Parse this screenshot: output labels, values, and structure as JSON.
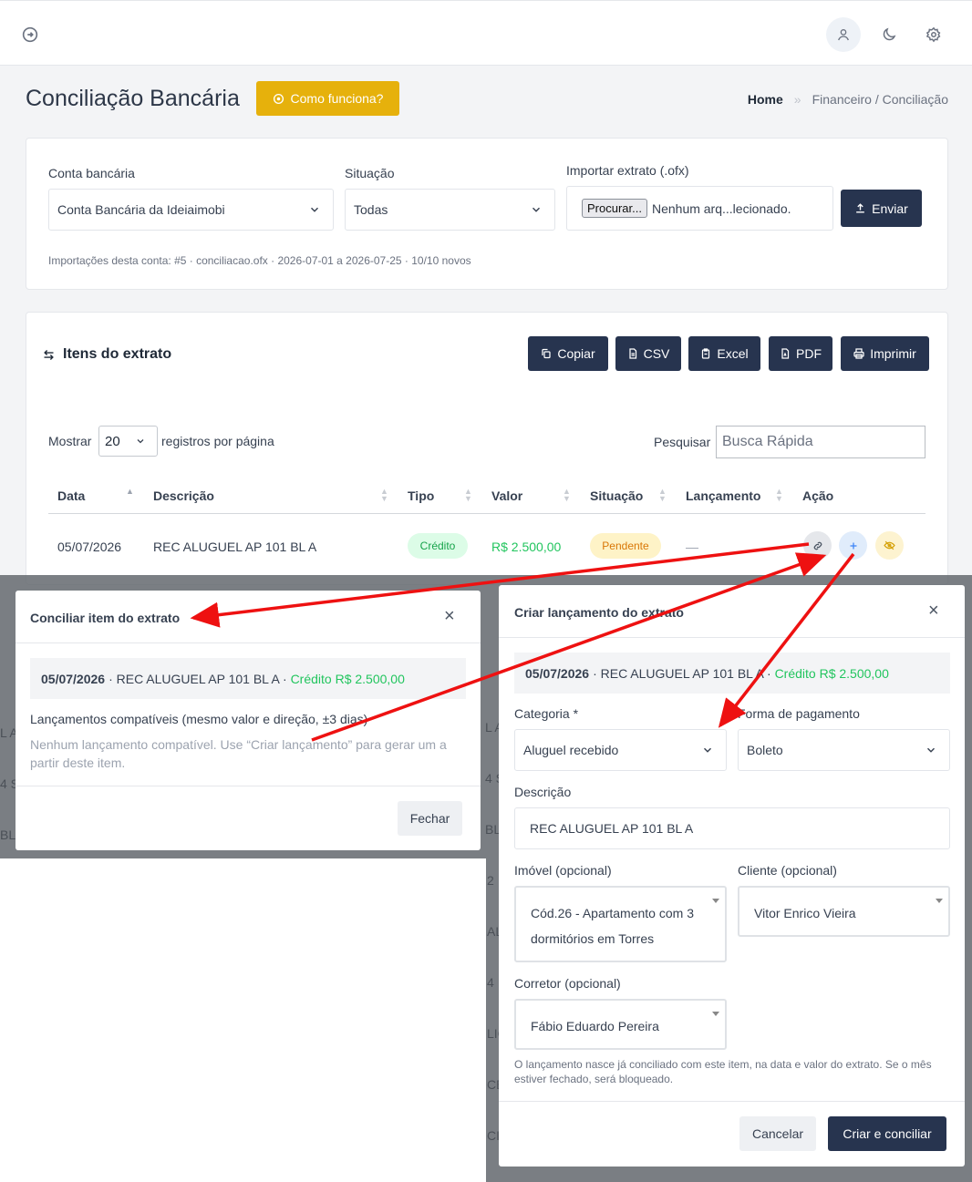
{
  "header": {
    "title": "Conciliação Bancária",
    "how_button": "Como funciona?"
  },
  "breadcrumb": {
    "home": "Home",
    "sep": "»",
    "path": "Financeiro / Conciliação"
  },
  "filters": {
    "conta_label": "Conta bancária",
    "conta_value": "Conta Bancária da Ideiaimobi",
    "situacao_label": "Situação",
    "situacao_value": "Todas",
    "import_label": "Importar extrato (.ofx)",
    "browse_label": "Procurar...",
    "file_status": "Nenhum arq...lecionado.",
    "send_button": "Enviar",
    "import_info": "Importações desta conta: #5 · conciliacao.ofx · 2026-07-01 a 2026-07-25 · 10/10 novos"
  },
  "items": {
    "title": "Itens do extrato",
    "buttons": {
      "copy": "Copiar",
      "csv": "CSV",
      "excel": "Excel",
      "pdf": "PDF",
      "print": "Imprimir"
    },
    "show_label": "Mostrar",
    "page_size": "20",
    "per_page_label": "registros por página",
    "search_label": "Pesquisar",
    "search_placeholder": "Busca Rápida",
    "columns": {
      "data": "Data",
      "descricao": "Descrição",
      "tipo": "Tipo",
      "valor": "Valor",
      "situacao": "Situação",
      "lancamento": "Lançamento",
      "acao": "Ação"
    },
    "row": {
      "data": "05/07/2026",
      "descricao": "REC ALUGUEL AP 101 BL A",
      "tipo": "Crédito",
      "valor": "R$ 2.500,00",
      "situacao": "Pendente",
      "lancamento": "—"
    }
  },
  "modal_conciliar": {
    "title": "Conciliar item do extrato",
    "item_date": "05/07/2026",
    "item_desc": "· REC ALUGUEL AP 101 BL A ·",
    "item_value": "Crédito R$ 2.500,00",
    "section_label": "Lançamentos compatíveis (mesmo valor e direção, ±3 dias)",
    "empty_hint": "Nenhum lançamento compatível. Use “Criar lançamento” para gerar um a partir deste item.",
    "close_button": "Fechar"
  },
  "modal_criar": {
    "title": "Criar lançamento do extrato",
    "item_date": "05/07/2026",
    "item_desc": "· REC ALUGUEL AP 101 BL A ·",
    "item_value": "Crédito R$ 2.500,00",
    "categoria_label": "Categoria *",
    "categoria_value": "Aluguel recebido",
    "forma_label": "Forma de pagamento",
    "forma_value": "Boleto",
    "descricao_label": "Descrição",
    "descricao_value": "REC ALUGUEL AP 101 BL A",
    "imovel_label": "Imóvel (opcional)",
    "imovel_value": "Cód.26 - Apartamento com 3 dormitórios em Torres",
    "cliente_label": "Cliente (opcional)",
    "cliente_value": "Vitor Enrico Vieira",
    "corretor_label": "Corretor (opcional)",
    "corretor_value": "Fábio Eduardo Pereira",
    "note": "O lançamento nasce já conciliado com este item, na data e valor do extrato. Se o mês estiver fechado, será bloqueado.",
    "cancel_button": "Cancelar",
    "submit_button": "Criar e conciliar"
  },
  "background_fragments": [
    "L A",
    "4 S",
    "BL",
    "L A",
    "4 S",
    "BL",
    "2",
    "AL",
    "4",
    "LIC",
    "CE",
    "CI"
  ],
  "colors": {
    "primary": "#27344f",
    "warning": "#e6b10c",
    "success": "#22c55e",
    "annotation": "#ee1111"
  }
}
